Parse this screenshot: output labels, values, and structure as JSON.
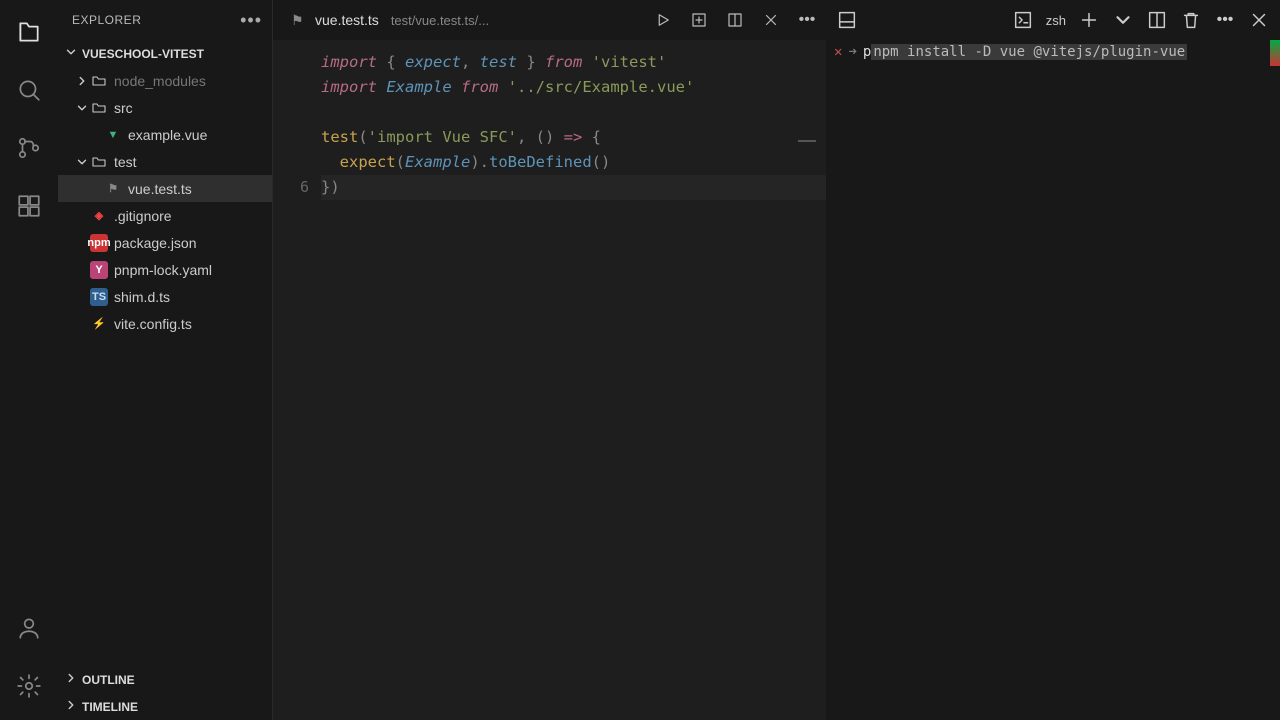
{
  "sidebar": {
    "title": "EXPLORER",
    "project": "VUESCHOOL-VITEST",
    "outline": "OUTLINE",
    "timeline": "TIMELINE",
    "tree": {
      "node_modules": "node_modules",
      "src": "src",
      "example_vue": "example.vue",
      "test": "test",
      "vue_test_ts": "vue.test.ts",
      "gitignore": ".gitignore",
      "package_json": "package.json",
      "pnpm_lock": "pnpm-lock.yaml",
      "shim_dts": "shim.d.ts",
      "vite_config": "vite.config.ts"
    }
  },
  "tab": {
    "filename": "vue.test.ts",
    "breadcrumb": "test/vue.test.ts/..."
  },
  "gutter_line": "6",
  "code": {
    "l1a": "import",
    "l1b": " { ",
    "l1c": "expect",
    "l1d": ", ",
    "l1e": "test",
    "l1f": " } ",
    "l1g": "from",
    "l1h": " ",
    "l1i": "'vitest'",
    "l2a": "import",
    "l2b": " ",
    "l2c": "Example",
    "l2d": " ",
    "l2e": "from",
    "l2f": " ",
    "l2g": "'../src/Example.vue'",
    "l4a": "test",
    "l4b": "(",
    "l4c": "'import Vue SFC'",
    "l4d": ", () ",
    "l4e": "=>",
    "l4f": " {",
    "l5a": "  ",
    "l5b": "expect",
    "l5c": "(",
    "l5d": "Example",
    "l5e": ").",
    "l5f": "toBeDefined",
    "l5g": "()",
    "l6a": "})"
  },
  "terminal": {
    "shell": "zsh",
    "prompt_x": "✕",
    "prompt_arrow": "➜",
    "typed": "p",
    "hint": "npm install -D vue @vitejs/plugin-vue"
  }
}
